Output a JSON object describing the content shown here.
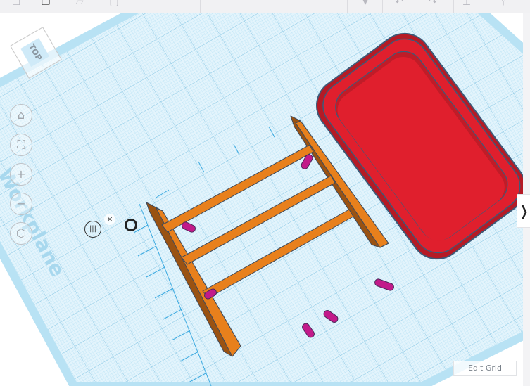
{
  "toolbar": {
    "icons": [
      "new-shape-icon",
      "duplicate-icon",
      "group-icon",
      "delete-icon",
      "light-bulb-icon",
      "undo-icon",
      "redo-icon",
      "align-icon",
      "mirror-icon"
    ]
  },
  "viewcube": {
    "face_label": "TOP"
  },
  "nav": {
    "home": "⌂",
    "fit": "⛶",
    "zoom_in": "+",
    "zoom_out": "−",
    "view_mode": "⬡"
  },
  "workplane": {
    "label": "Workplane"
  },
  "snap": {
    "icon": "|||",
    "close": "×"
  },
  "edit_grid": {
    "label": "Edit Grid"
  },
  "panel_toggle": {
    "label": "❭"
  },
  "colors": {
    "grid_bg": "#d6eef9",
    "grid_line": "#8ccbe8",
    "box_red": "#e01f2d",
    "box_dark": "#b51a25",
    "frame_orange": "#e8801c",
    "frame_dark": "#9a5212",
    "peg_magenta": "#c21a8a"
  }
}
